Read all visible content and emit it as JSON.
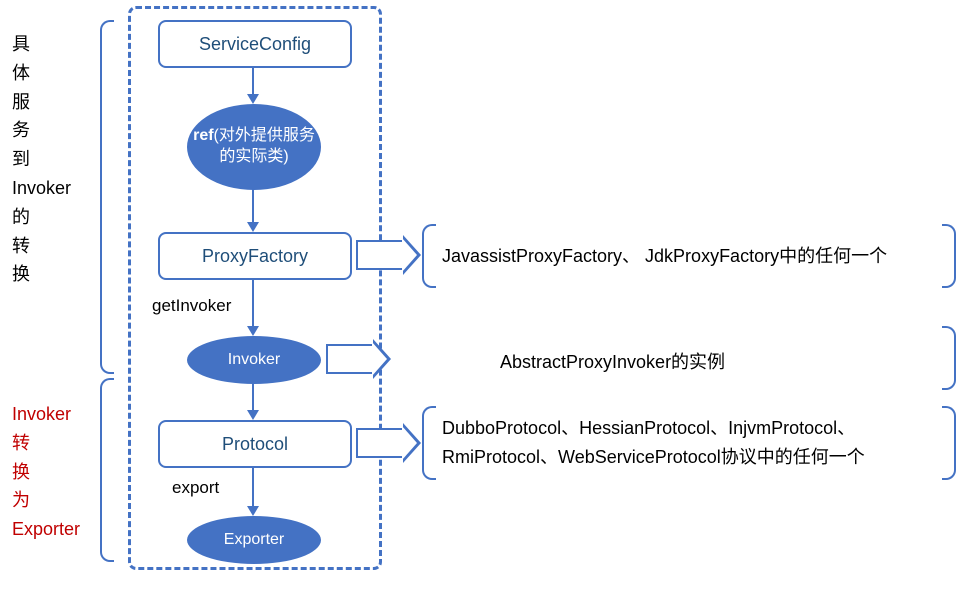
{
  "leftLabel1": {
    "l1": "具",
    "l2": "体",
    "l3": "服",
    "l4": "务",
    "l5": "到",
    "l6": "Invoker",
    "l7": "的",
    "l8": "转",
    "l9": "换"
  },
  "leftLabel2": {
    "l1": "Invoker",
    "l2": "转",
    "l3": "换",
    "l4": "为",
    "l5": "Exporter"
  },
  "boxes": {
    "serviceConfig": "ServiceConfig",
    "proxyFactory": "ProxyFactory",
    "protocol": "Protocol"
  },
  "ovals": {
    "refBold": "ref",
    "refText": "(对外提供服务的实际类)",
    "invoker": "Invoker",
    "exporter": "Exporter"
  },
  "labels": {
    "getInvoker": "getInvoker",
    "export": "export"
  },
  "desc": {
    "proxy": "JavassistProxyFactory、 JdkProxyFactory中的任何一个",
    "invoker": "AbstractProxyInvoker的实例",
    "protocol": "DubboProtocol、HessianProtocol、InjvmProtocol、RmiProtocol、WebServiceProtocol协议中的任何一个"
  }
}
